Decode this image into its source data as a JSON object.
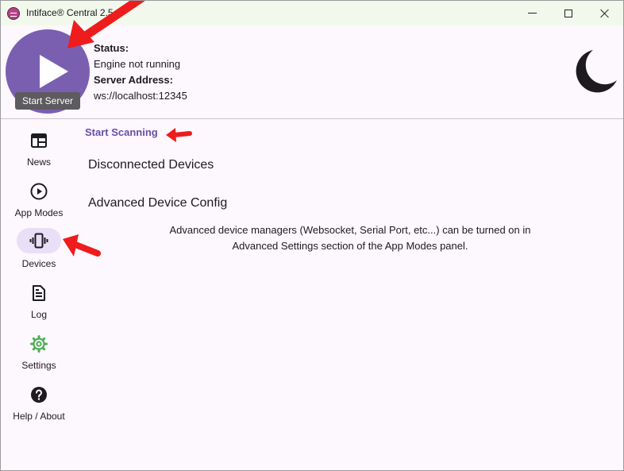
{
  "window": {
    "title": "Intiface® Central 2.5.0",
    "controls": [
      "minimize",
      "maximize",
      "close"
    ]
  },
  "header": {
    "start_button_tooltip": "Start Server",
    "status_label": "Status:",
    "status_value": "Engine not running",
    "server_address_label": "Server Address:",
    "server_address_value": "ws://localhost:12345",
    "theme_icon": "moon-icon"
  },
  "sidebar": {
    "items": [
      {
        "label": "News",
        "icon": "news-icon",
        "active": false
      },
      {
        "label": "App Modes",
        "icon": "play-circle-icon",
        "active": false
      },
      {
        "label": "Devices",
        "icon": "vibration-icon",
        "active": true
      },
      {
        "label": "Log",
        "icon": "document-icon",
        "active": false
      },
      {
        "label": "Settings",
        "icon": "gear-icon",
        "active": false,
        "color": "#4caf50"
      },
      {
        "label": "Help / About",
        "icon": "help-icon",
        "active": false
      }
    ]
  },
  "main": {
    "start_scanning": "Start Scanning",
    "disconnected_devices": "Disconnected Devices",
    "advanced_device_config": "Advanced Device Config",
    "notice_line1": "Advanced device managers (Websocket, Serial Port, etc...) can be turned on in",
    "notice_line2": "Advanced Settings section of the App Modes panel."
  },
  "colors": {
    "accent": "#6750a4",
    "start_button": "#7a5fb0",
    "annotation": "#ee1c1c",
    "settings_icon": "#4caf50",
    "titlebar": "#f2f9ec",
    "background": "#fdf7fe"
  }
}
